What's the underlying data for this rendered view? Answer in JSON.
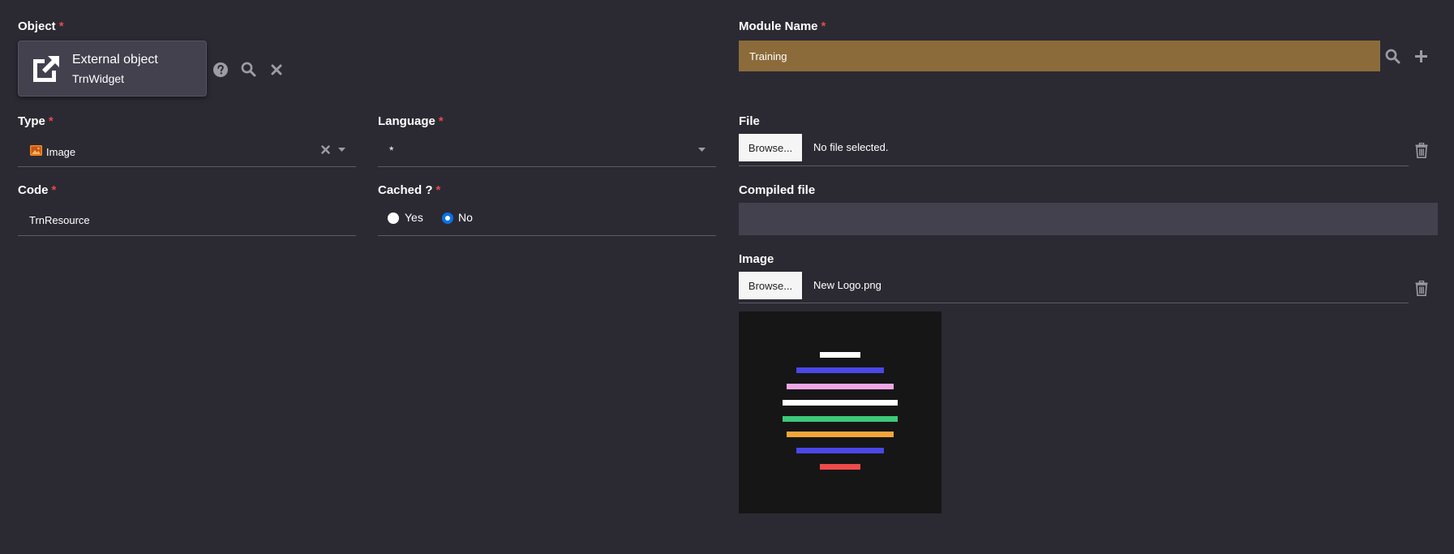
{
  "object": {
    "label": "Object",
    "required_mark": "*",
    "card_title": "External object",
    "card_subtitle": "TrnWidget"
  },
  "module_name": {
    "label": "Module Name",
    "required_mark": "*",
    "value": "Training"
  },
  "type": {
    "label": "Type",
    "required_mark": "*",
    "value": "Image"
  },
  "language": {
    "label": "Language",
    "required_mark": "*",
    "value": "*"
  },
  "file": {
    "label": "File",
    "browse_label": "Browse...",
    "filename": "No file selected."
  },
  "code": {
    "label": "Code",
    "required_mark": "*",
    "value": "TrnResource"
  },
  "cached": {
    "label": "Cached ?",
    "required_mark": "*",
    "options": [
      "Yes",
      "No"
    ],
    "selected": "No"
  },
  "compiled_file": {
    "label": "Compiled file",
    "value": ""
  },
  "image": {
    "label": "Image",
    "browse_label": "Browse...",
    "filename": "New Logo.png",
    "stripe_colors": [
      "#ffffff",
      "#4a47e8",
      "#f0a6e6",
      "#ffffff",
      "#3ec97a",
      "#f2a53a",
      "#4a47e8",
      "#ee4b4b"
    ]
  },
  "colors": {
    "background": "#2b2a33",
    "module_input_bg": "#8c6b3b",
    "required": "#e5484d",
    "radio_selected": "#0a72e8"
  },
  "icons": {
    "object_card": "external-link-icon",
    "help": "question-circle-icon",
    "search": "search-icon",
    "clear": "close-icon",
    "add": "plus-icon",
    "type": "image-icon",
    "dropdown": "caret-down-icon",
    "delete": "trash-icon"
  }
}
